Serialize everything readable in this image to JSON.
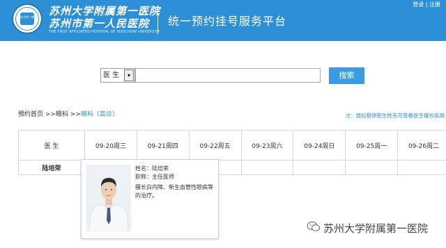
{
  "header": {
    "brand_line1": "苏州大学附属第一医院",
    "brand_line2": "苏州市第一人民医院",
    "brand_en": "THE FIRST AFFILIATED HOSPITAL OF SOOCHOW UNIVERSITY",
    "seal_text": "苏大附一院",
    "platform_title": "统一预约挂号服务平台",
    "login_label": "登录",
    "separator": "|",
    "register_label": "注册"
  },
  "search": {
    "select_value": "医 生",
    "button_label": "搜索"
  },
  "breadcrumb": {
    "home": "预约首页",
    "sep1": ">>",
    "dept": "眼科",
    "sep2": ">>",
    "current": "眼科（高诊）"
  },
  "hint": "注：鼠标悬停医生姓名可查看医生擅长疾病",
  "schedule": {
    "doctor_header": "医 生",
    "dates": [
      "09-20周三",
      "09-21周四",
      "09-22周五",
      "09-23周六",
      "09-24周日",
      "09-25周一",
      "09-26周二"
    ],
    "rows": [
      {
        "doctor": "陆培荣"
      }
    ]
  },
  "popup": {
    "name_line": "姓名：陆培荣",
    "title_line": "职称：主任医师",
    "desc": "擅长白内障、新生血管性眼病等的治疗。"
  },
  "watermark": {
    "text": "苏州大学附属第一医院"
  }
}
